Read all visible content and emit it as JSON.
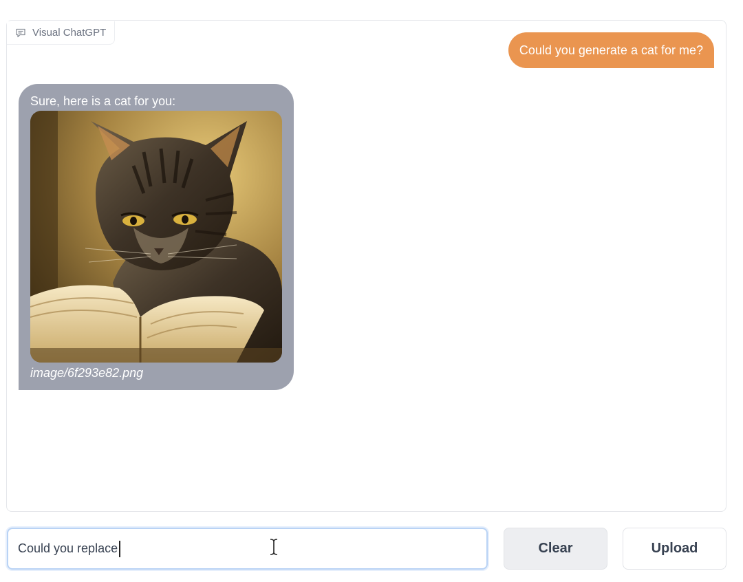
{
  "panel": {
    "label": "Visual ChatGPT",
    "label_icon": "chat-icon"
  },
  "messages": {
    "user": {
      "text": "Could you generate a cat for me?",
      "color": "#ea9550"
    },
    "bot": {
      "text": "Sure, here is a cat for you:",
      "image_alt": "cat-reading-book-image",
      "image_path": "image/6f293e82.png",
      "color": "#9da1ae"
    }
  },
  "input": {
    "value": "Could you replace"
  },
  "buttons": {
    "clear_label": "Clear",
    "upload_label": "Upload"
  }
}
